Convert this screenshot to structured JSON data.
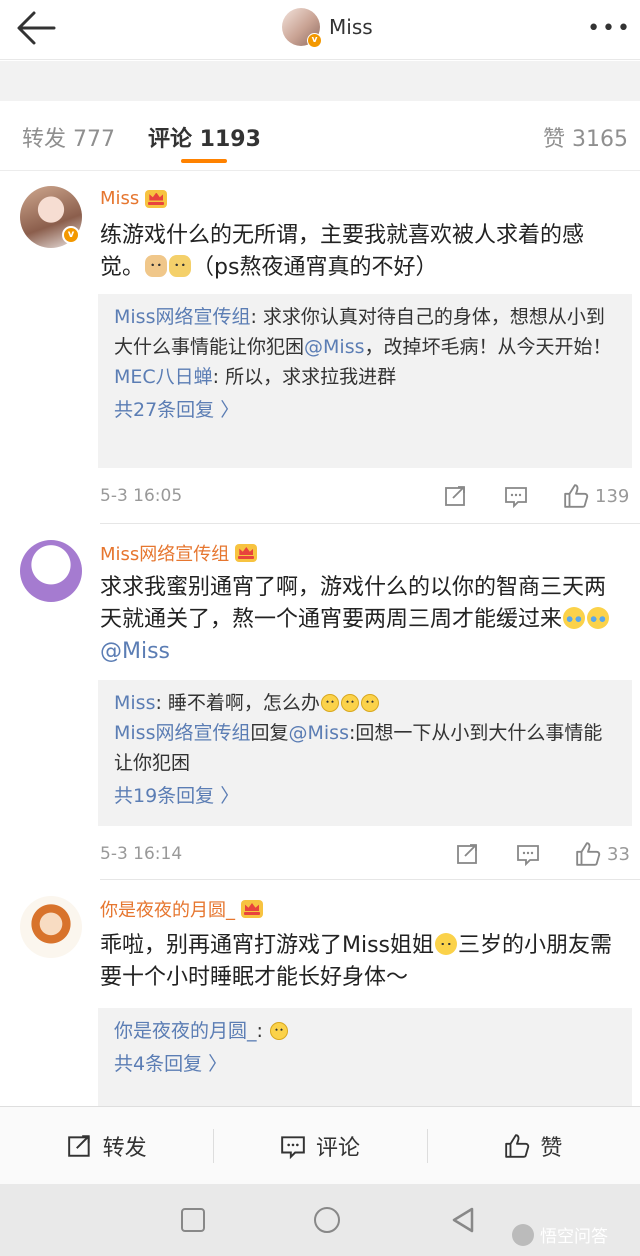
{
  "header": {
    "title": "Miss"
  },
  "tabs": {
    "repost": "转发 777",
    "comment": "评论 1193",
    "like": "赞 3165"
  },
  "comments": [
    {
      "name": "Miss",
      "text_a": "练游戏什么的无所谓，主要我就喜欢被人求着的感觉。",
      "text_b": "（ps熬夜通宵真的不好）",
      "replies": [
        {
          "name": "Miss网络宣传组",
          "text": ": 求求你认真对待自己的身体，想想从小到大什么事情能让你犯困",
          "mention": "@Miss",
          "text2": "，改掉坏毛病！从今天开始！"
        },
        {
          "name": "MEC八日蝉",
          "text": ": 所以，求求拉我进群"
        }
      ],
      "more": "共27条回复 〉",
      "time": "5-3 16:05",
      "likes": "139"
    },
    {
      "name": "Miss网络宣传组",
      "text_a": "求求我蜜别通宵了啊，游戏什么的以你的智商三天两天就通关了，熬一个通宵要两周三周才能缓过来",
      "mention": "@Miss",
      "replies": [
        {
          "name": "Miss",
          "text": ": 睡不着啊，怎么办"
        },
        {
          "name": "Miss网络宣传组",
          "text": "回复",
          "mention": "@Miss",
          "text2": ":回想一下从小到大什么事情能让你犯困"
        }
      ],
      "more": "共19条回复 〉",
      "time": "5-3 16:14",
      "likes": "33"
    },
    {
      "name": "你是夜夜的月圆_",
      "text_a": "乖啦，别再通宵打游戏了Miss姐姐",
      "text_b": "三岁的小朋友需要十个小时睡眠才能长好身体～",
      "replies": [
        {
          "name": "你是夜夜的月圆_",
          "text": ": "
        }
      ],
      "more": "共4条回复 〉"
    }
  ],
  "bottom": {
    "repost": "转发",
    "comment": "评论",
    "like": "赞"
  },
  "watermark": "悟空问答",
  "colors": {
    "accent": "#ff8200",
    "name": "#e6762f",
    "link": "#5b7db4",
    "verified": "#f39800"
  },
  "icons": [
    "back-arrow-icon",
    "more-dots-icon",
    "crown-badge-icon",
    "verified-badge-icon",
    "repost-icon",
    "comment-icon",
    "thumb-up-icon",
    "home-square-icon",
    "home-circle-icon",
    "back-triangle-icon"
  ]
}
